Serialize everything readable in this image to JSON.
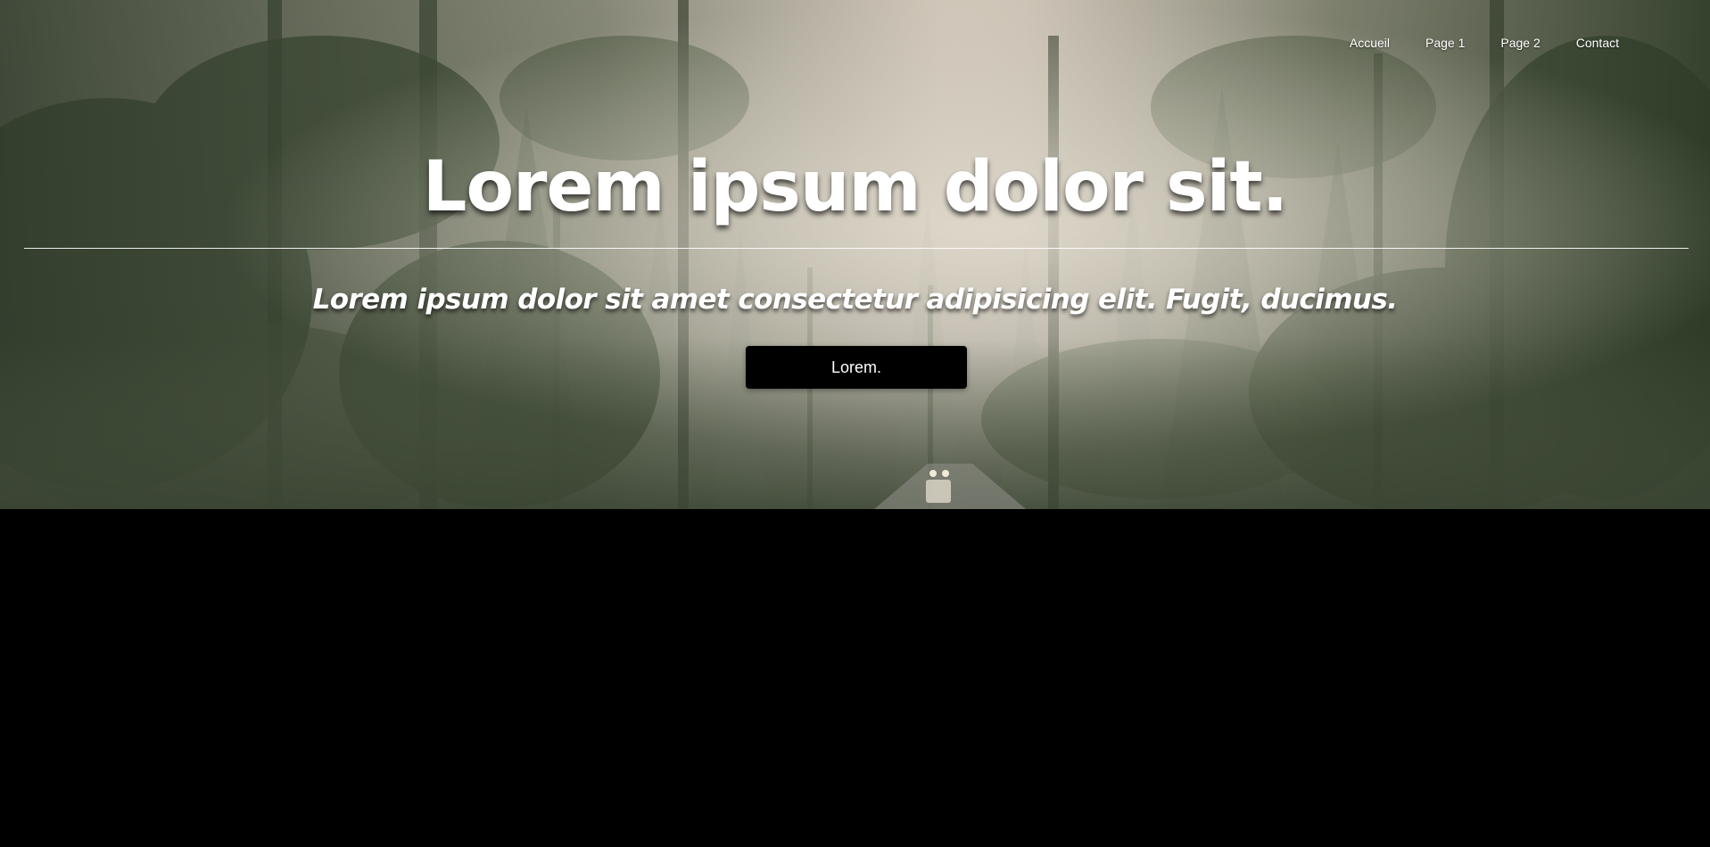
{
  "nav": {
    "items": [
      {
        "label": "Accueil"
      },
      {
        "label": "Page 1"
      },
      {
        "label": "Page 2"
      },
      {
        "label": "Contact"
      }
    ]
  },
  "hero": {
    "title": "Lorem ipsum dolor sit.",
    "subtitle": "Lorem ipsum dolor sit amet consectetur adipisicing elit. Fugit, ducimus.",
    "button_label": "Lorem."
  },
  "colors": {
    "text": "#ffffff",
    "button_bg": "#000000",
    "page_bg": "#000000"
  }
}
